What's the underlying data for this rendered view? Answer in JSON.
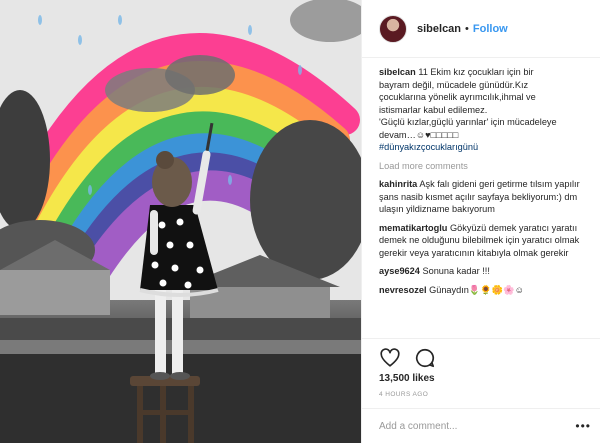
{
  "header": {
    "username": "sibelcan",
    "separator": "•",
    "follow_label": "Follow"
  },
  "caption": {
    "username": "sibelcan",
    "lines": [
      "11 Ekim kız çocukları için bir",
      "bayram değil, mücadele günüdür.Kız",
      "çocuklarına yönelik ayrımcılık,ihmal ve",
      "istismarlar kabul edilemez.",
      "'Güçlü kızlar,güçlü yarınlar' için mücadeleye",
      "devam…☺♥□□□□□",
      "#dünyakızçocuklarıgünü"
    ]
  },
  "load_more_label": "Load more comments",
  "comments": [
    {
      "username": "kahinrita",
      "text": "Aşk falı gideni geri getirme tılsım yapılır şans nasib kısmet açılır sayfaya bekliyorum:) dm ulaşın yildizname bakıyorum"
    },
    {
      "username": "mematikartoglu",
      "text": "Gökyüzü demek yaratıcı yaratıı demek ne olduğunu bilebilmek için yaratıcı olmak gerekir veya yaratıcının kitabıyla olmak gerekir"
    },
    {
      "username": "ayse9624",
      "text": "Sonuna kadar !!!"
    },
    {
      "username": "nevresozel",
      "text": "Günaydın🌷🌻🌼🌸☺"
    }
  ],
  "likes_label": "13,500 likes",
  "time_label": "4 HOURS AGO",
  "add_comment_placeholder": "Add a comment...",
  "more_label": "•••",
  "icons": {
    "like": "heart-icon",
    "comment": "comment-icon",
    "more": "more-options-icon"
  },
  "colors": {
    "follow": "#3897f0",
    "muted": "#999999",
    "text": "#262626",
    "hashtag": "#003569"
  }
}
